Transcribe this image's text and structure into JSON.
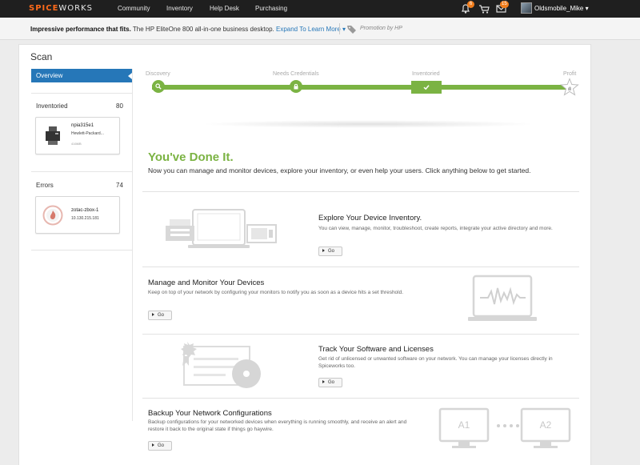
{
  "nav": {
    "logo_a": "SPICE",
    "logo_b": "WORKS",
    "items": [
      "Community",
      "Inventory",
      "Help Desk",
      "Purchasing"
    ],
    "notifications_badge": "6",
    "cart_badge": "",
    "messages_badge": "15",
    "username": "Oldsmobile_Mike"
  },
  "promo": {
    "headline": "Impressive performance that fits.",
    "body": "The HP EliteOne 800 all-in-one business desktop.",
    "link": "Expand To Learn More",
    "by": "Promotion by HP"
  },
  "page": {
    "title": "Scan"
  },
  "sidebar": {
    "overview": "Overview",
    "inventoried": {
      "label": "Inventoried",
      "count": "80",
      "device": {
        "name": "npia315e1",
        "vendor": "Hewlett-Packard...",
        "tag": "416MB"
      }
    },
    "errors": {
      "label": "Errors",
      "count": "74",
      "device": {
        "name": "zotac-zbox-1",
        "ip": "10.130.215.181"
      }
    }
  },
  "progress": {
    "steps": [
      "Discovery",
      "Needs Credentials",
      "Inventoried",
      "Profit"
    ]
  },
  "done": {
    "title": "You've Done It.",
    "subtitle": "Now you can manage and monitor devices, explore your inventory, or even help your users. Click anything below to get started."
  },
  "features": [
    {
      "title": "Explore Your Device Inventory.",
      "desc": "You can view, manage, monitor, troubleshoot, create reports, integrate your active directory and more.",
      "button": "Go"
    },
    {
      "title": "Manage and Monitor Your Devices",
      "desc": "Keep on top of your network by configuring your monitors to notify you as soon as a device hits a set threshold.",
      "button": "Go"
    },
    {
      "title": "Track Your Software and Licenses",
      "desc": "Get rid of unlicensed or unwanted software on your network. You can manage your licenses directly in Spiceworks too.",
      "button": "Go"
    },
    {
      "title": "Backup Your Network Configurations",
      "desc": "Backup configurations for your networked devices when everything is running smoothly, and receive an alert and restore it back to the original state if things go haywire.",
      "button": "Go"
    }
  ],
  "backup_labels": {
    "a": "A1",
    "b": "A2"
  },
  "colors": {
    "accent": "#7bb343",
    "link": "#2677b8",
    "brand": "#ff6a1a",
    "badge": "#f07d1c"
  }
}
